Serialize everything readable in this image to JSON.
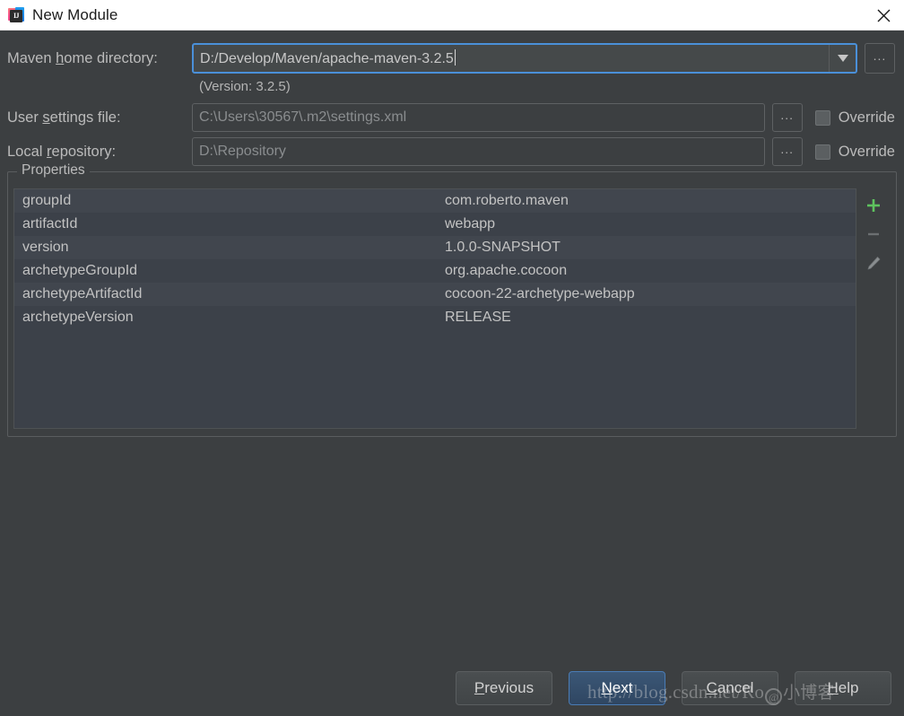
{
  "window": {
    "title": "New Module",
    "icon": "intellij-idea-icon",
    "close_label": "✕"
  },
  "form": {
    "maven_home": {
      "label_before": "Maven ",
      "label_mnemonic": "h",
      "label_after": "ome directory:",
      "value": "D:/Develop/Maven/apache-maven-3.2.5",
      "browse_label": "...",
      "version_note": "(Version: 3.2.5)"
    },
    "user_settings": {
      "label_before": "User ",
      "label_mnemonic": "s",
      "label_after": "ettings file:",
      "value": "C:\\Users\\30567\\.m2\\settings.xml",
      "browse_label": "...",
      "override_label": "Override",
      "override_checked": false
    },
    "local_repository": {
      "label_before": "Local ",
      "label_mnemonic": "r",
      "label_after": "epository:",
      "value": "D:\\Repository",
      "browse_label": "...",
      "override_label": "Override",
      "override_checked": false
    }
  },
  "properties": {
    "group_title": "Properties",
    "rows": [
      {
        "key": "groupId",
        "value": "com.roberto.maven"
      },
      {
        "key": "artifactId",
        "value": "webapp"
      },
      {
        "key": "version",
        "value": "1.0.0-SNAPSHOT"
      },
      {
        "key": "archetypeGroupId",
        "value": "org.apache.cocoon"
      },
      {
        "key": "archetypeArtifactId",
        "value": "cocoon-22-archetype-webapp"
      },
      {
        "key": "archetypeVersion",
        "value": "RELEASE"
      }
    ],
    "toolbar": {
      "add_label": "+",
      "remove_label": "−",
      "edit_label": "edit"
    },
    "accent_add_color": "#5ec25e"
  },
  "footer": {
    "previous": {
      "before": "",
      "mnemonic": "P",
      "after": "revious"
    },
    "next": {
      "before": "",
      "mnemonic": "N",
      "after": "ext"
    },
    "cancel": {
      "before": "",
      "mnemonic": "C",
      "after": "ancel"
    },
    "help": {
      "before": "",
      "mnemonic": "H",
      "after": "elp"
    }
  },
  "watermark": {
    "text_left": "http://blog.csdn.net/Ro",
    "logo": "@",
    "text_right": "小博客"
  }
}
